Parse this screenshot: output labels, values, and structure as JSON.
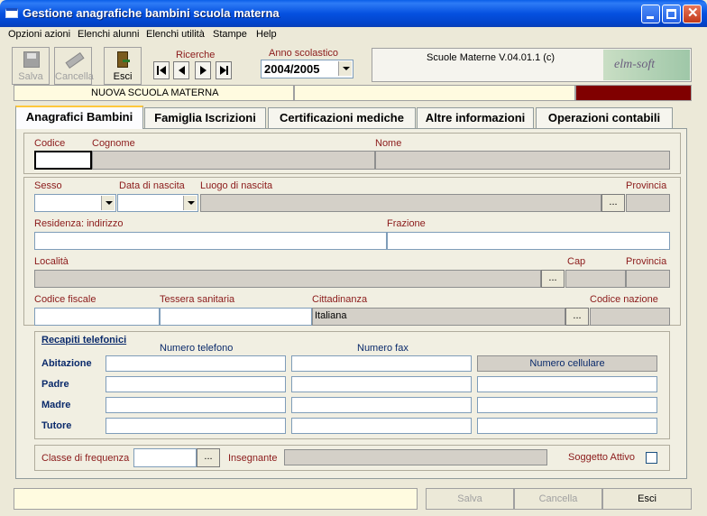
{
  "window": {
    "title": "Gestione anagrafiche bambini scuola materna"
  },
  "menu": [
    "Opzioni azioni",
    "Elenchi alunni",
    "Elenchi utilità",
    "Stampe",
    "Help"
  ],
  "toolbar": {
    "save_label": "Salva",
    "cancel_label": "Cancella",
    "exit_label": "Esci",
    "search_label": "Ricerche",
    "school_year_label": "Anno scolastico",
    "school_year_value": "2004/2005",
    "version": "Scuole Materne V.04.01.1 (c)",
    "logo_text": "elm-soft"
  },
  "school": {
    "name": "NUOVA SCUOLA MATERNA"
  },
  "tabs": [
    "Anagrafici Bambini",
    "Famiglia Iscrizioni",
    "Certificazioni mediche",
    "Altre informazioni",
    "Operazioni contabili"
  ],
  "fields": {
    "codice": "Codice",
    "cognome": "Cognome",
    "nome": "Nome",
    "sesso": "Sesso",
    "data_nascita": "Data di nascita",
    "luogo_nascita": "Luogo di nascita",
    "provincia": "Provincia",
    "residenza": "Residenza: indirizzo",
    "frazione": "Frazione",
    "localita": "Località",
    "cap": "Cap",
    "provincia2": "Provincia",
    "codice_fiscale": "Codice fiscale",
    "tessera": "Tessera sanitaria",
    "cittadinanza": "Cittadinanza",
    "cittadinanza_value": "Italiana",
    "codice_nazione": "Codice nazione"
  },
  "phones": {
    "title": "Recapiti telefonici",
    "col_phone": "Numero telefono",
    "col_fax": "Numero fax",
    "col_mobile": "Numero cellulare",
    "rows": [
      "Abitazione",
      "Padre",
      "Madre",
      "Tutore"
    ]
  },
  "class_section": {
    "classe": "Classe di frequenza",
    "insegnante": "Insegnante",
    "soggetto": "Soggetto Attivo"
  },
  "bottom": {
    "save": "Salva",
    "cancel": "Cancella",
    "exit": "Esci"
  },
  "ellipsis": "..."
}
